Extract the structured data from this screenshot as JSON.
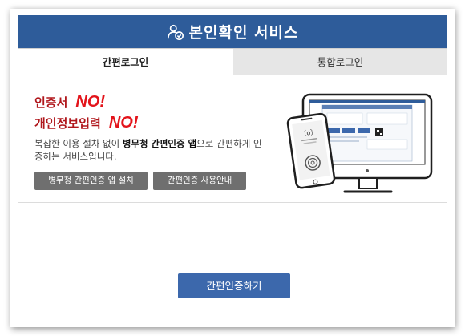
{
  "header": {
    "title": "본인확인 서비스",
    "icon": "user-check-icon"
  },
  "tabs": [
    {
      "label": "간편로그인",
      "active": true
    },
    {
      "label": "통합로그인",
      "active": false
    }
  ],
  "intro": {
    "line1_label": "인증서",
    "line1_badge": "NO!",
    "line2_label": "개인정보입력",
    "line2_badge": "NO!",
    "description_pre": "복잡한 이용 절차 없이 ",
    "description_bold1": "병무청",
    "description_mid": " ",
    "description_bold2": "간편인증 앱",
    "description_post": "으로 간편하게 인증하는 서비스입니다."
  },
  "buttons": {
    "install": "병무청 간편인증 앱 설치",
    "guide": "간편인증 사용안내",
    "authenticate": "간편인증하기"
  },
  "colors": {
    "header_bg": "#2e5c9a",
    "badge_red": "#e3141b",
    "label_red": "#b0171c",
    "primary_button": "#3c68ac",
    "secondary_button": "#6f6f6f"
  }
}
